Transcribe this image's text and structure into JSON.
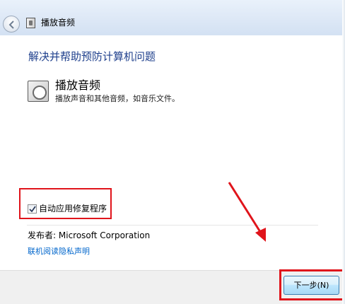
{
  "window": {
    "title": "播放音频"
  },
  "main": {
    "heading": "解决并帮助预防计算机问题",
    "item": {
      "title": "播放音频",
      "description": "播放声音和其他音频，如音乐文件。"
    },
    "auto_repair": {
      "label": "自动应用修复程序",
      "checked": true
    },
    "publisher": {
      "label": "发布者:",
      "name": "Microsoft Corporation"
    },
    "privacy_link": "联机阅读隐私声明"
  },
  "footer": {
    "next_label": "下一步(N)"
  },
  "annotations": {
    "highlight_color": "#e0141b"
  }
}
